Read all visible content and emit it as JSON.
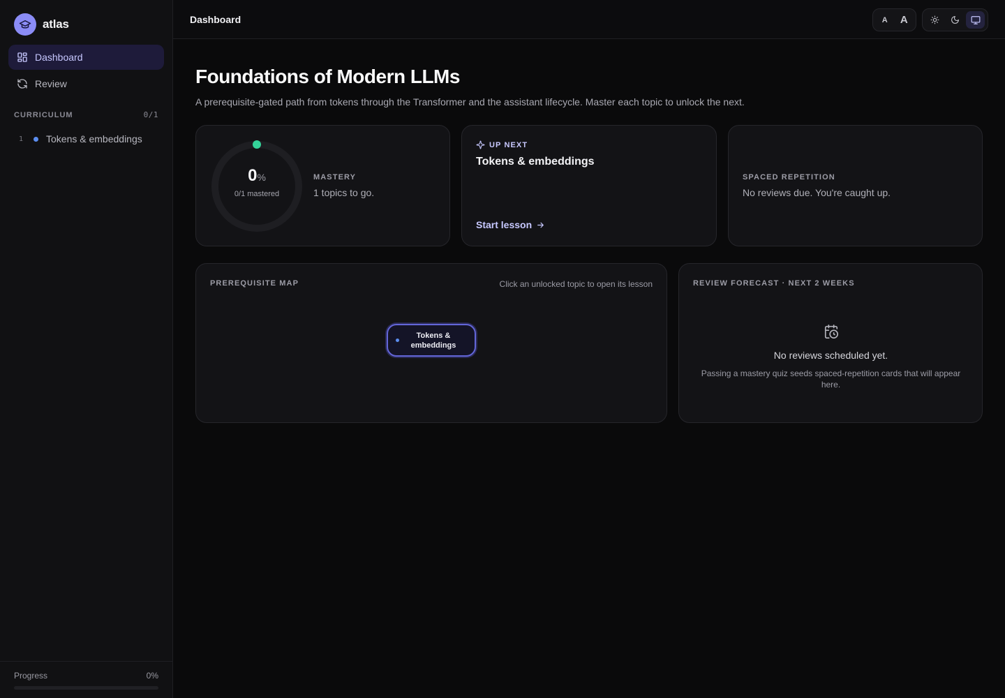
{
  "brand": {
    "name": "atlas"
  },
  "nav": [
    {
      "label": "Dashboard",
      "icon": "dashboard-grid-icon",
      "active": true
    },
    {
      "label": "Review",
      "icon": "refresh-icon",
      "active": false
    }
  ],
  "curriculum": {
    "heading": "CURRICULUM",
    "count": "0/1",
    "items": [
      {
        "number": "1",
        "label": "Tokens & embeddings",
        "status_color": "#5b8def"
      }
    ]
  },
  "sidebar_footer": {
    "label": "Progress",
    "value": "0%",
    "fraction": 0
  },
  "topbar": {
    "title": "Dashboard",
    "font_small_label": "A",
    "font_large_label": "A",
    "theme_options": [
      "light-sun-icon",
      "dark-moon-icon",
      "system-monitor-icon"
    ],
    "active_theme": "system"
  },
  "page": {
    "title": "Foundations of Modern LLMs",
    "subtitle": "A prerequisite-gated path from tokens through the Transformer and the assistant lifecycle. Master each topic to unlock the next."
  },
  "mastery_card": {
    "percent": "0",
    "percent_sign": "%",
    "mastered_text": "0/1 mastered",
    "label": "MASTERY",
    "text": "1 topics to go.",
    "fraction": 0,
    "accent": "#34d399"
  },
  "up_next_card": {
    "label": "UP NEXT",
    "title": "Tokens & embeddings",
    "link": "Start lesson"
  },
  "spaced_card": {
    "label": "SPACED REPETITION",
    "text": "No reviews due. You're caught up."
  },
  "prereq_card": {
    "label": "PREREQUISITE MAP",
    "hint": "Click an unlocked topic to open its lesson",
    "nodes": [
      {
        "line1": "Tokens &",
        "line2": "embeddings"
      }
    ]
  },
  "forecast_card": {
    "label": "REVIEW FORECAST · NEXT 2 WEEKS",
    "empty_title": "No reviews scheduled yet.",
    "empty_text": "Passing a mastery quiz seeds spaced-repetition cards that will appear here."
  },
  "colors": {
    "accent": "#8b8cf6",
    "background": "#0a0a0b",
    "sidebar": "#111113",
    "card": "#131316",
    "mastery_dot": "#34d399",
    "topic_dot": "#5b8def"
  }
}
